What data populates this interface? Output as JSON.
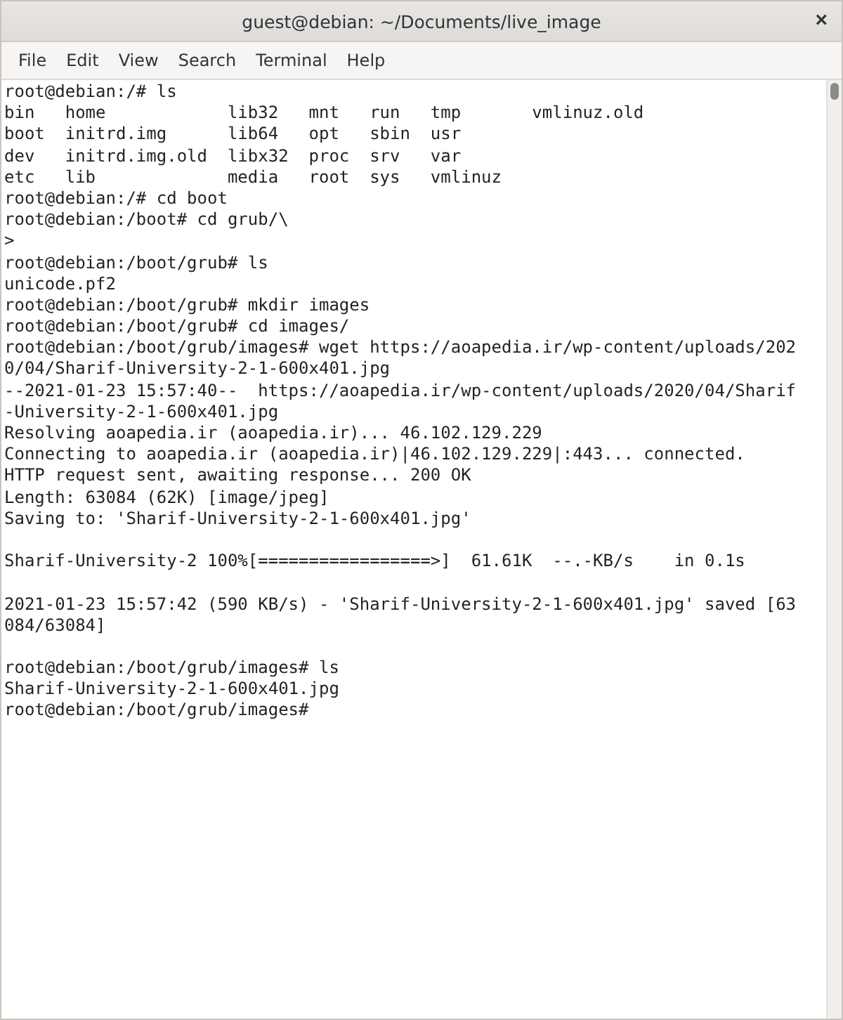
{
  "window": {
    "title": "guest@debian: ~/Documents/live_image",
    "close_glyph": "×"
  },
  "menu": [
    "File",
    "Edit",
    "View",
    "Search",
    "Terminal",
    "Help"
  ],
  "terminal": {
    "lines": [
      {
        "kind": "text",
        "text": "root@debian:/# ls"
      },
      {
        "kind": "text",
        "text": "bin   home            lib32   mnt   run   tmp       vmlinuz.old"
      },
      {
        "kind": "text",
        "text": "boot  initrd.img      lib64   opt   sbin  usr"
      },
      {
        "kind": "text",
        "text": "dev   initrd.img.old  libx32  proc  srv   var"
      },
      {
        "kind": "text",
        "text": "etc   lib             media   root  sys   vmlinuz"
      },
      {
        "kind": "text",
        "text": "root@debian:/# cd boot"
      },
      {
        "kind": "text",
        "text": "root@debian:/boot# cd grub/\\"
      },
      {
        "kind": "text",
        "text": ">"
      },
      {
        "kind": "text",
        "text": "root@debian:/boot/grub# ls"
      },
      {
        "kind": "text",
        "text": "unicode.pf2"
      },
      {
        "kind": "text",
        "text": "root@debian:/boot/grub# mkdir images"
      },
      {
        "kind": "text",
        "text": "root@debian:/boot/grub# cd images/"
      },
      {
        "kind": "text",
        "text": "root@debian:/boot/grub/images# wget https://aoapedia.ir/wp-content/uploads/202"
      },
      {
        "kind": "text",
        "text": "0/04/Sharif-University-2-1-600x401.jpg"
      },
      {
        "kind": "text",
        "text": "--2021-01-23 15:57:40--  https://aoapedia.ir/wp-content/uploads/2020/04/Sharif"
      },
      {
        "kind": "text",
        "text": "-University-2-1-600x401.jpg"
      },
      {
        "kind": "text",
        "text": "Resolving aoapedia.ir (aoapedia.ir)... 46.102.129.229"
      },
      {
        "kind": "text",
        "text": "Connecting to aoapedia.ir (aoapedia.ir)|46.102.129.229|:443... connected."
      },
      {
        "kind": "text",
        "text": "HTTP request sent, awaiting response... 200 OK"
      },
      {
        "kind": "text",
        "text": "Length: 63084 (62K) [image/jpeg]"
      },
      {
        "kind": "text",
        "text": "Saving to: 'Sharif-University-2-1-600x401.jpg'"
      },
      {
        "kind": "blank"
      },
      {
        "kind": "text",
        "text": "Sharif-University-2 100%[=================>]  61.61K  --.-KB/s    in 0.1s"
      },
      {
        "kind": "blank"
      },
      {
        "kind": "text",
        "text": "2021-01-23 15:57:42 (590 KB/s) - 'Sharif-University-2-1-600x401.jpg' saved [63"
      },
      {
        "kind": "text",
        "text": "084/63084]"
      },
      {
        "kind": "blank"
      },
      {
        "kind": "text",
        "text": "root@debian:/boot/grub/images# ls"
      },
      {
        "kind": "text",
        "text": "Sharif-University-2-1-600x401.jpg"
      },
      {
        "kind": "text",
        "text": "root@debian:/boot/grub/images#"
      }
    ]
  }
}
